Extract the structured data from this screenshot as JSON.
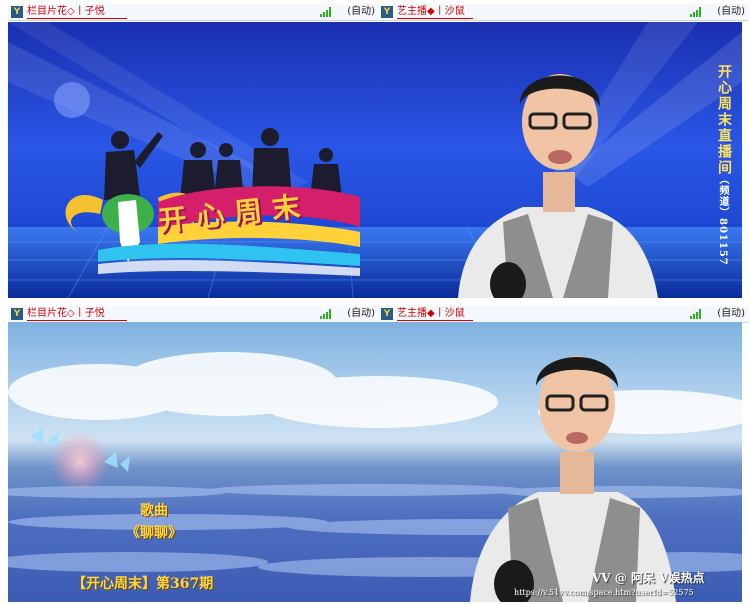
{
  "panel1": {
    "left_bar": {
      "icon": "vy-logo-icon",
      "name": "栏目片花◇丨子悦",
      "status": "(自动)"
    },
    "right_bar": {
      "icon": "vy-logo-icon",
      "name": "艺主播◆丨沙鼠",
      "status": "(自动)"
    },
    "video": {
      "logo_text": "开心周末",
      "side_title": "开心周末直播间",
      "side_id": "（频道）801157"
    }
  },
  "panel2": {
    "left_bar": {
      "icon": "vy-logo-icon",
      "name": "栏目片花◇丨子悦",
      "status": "(自动)"
    },
    "right_bar": {
      "icon": "vy-logo-icon",
      "name": "艺主播◆丨沙鼠",
      "status": "(自动)"
    },
    "video": {
      "song_label": "歌曲",
      "song_title": "《聊聊》",
      "episode": "【开心周末】第367期",
      "watermark": "VV @ 阿呆 V娱热点",
      "url": "https://v.51vv.com/space.htm?userId=52575"
    }
  },
  "colors": {
    "name_red": "#d40000",
    "signal_green": "#29b11e",
    "bar_bg": "#f4f8fc"
  }
}
